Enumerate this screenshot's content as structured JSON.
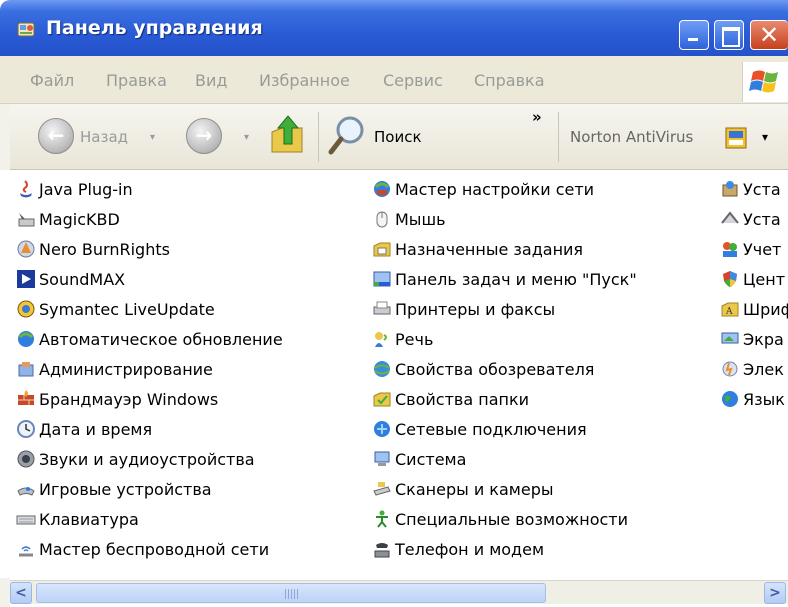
{
  "window": {
    "title": "Панель управления",
    "colors": {
      "titlebar": "#2a5bd6",
      "close": "#c7401d",
      "menubar": "#ece9d8"
    }
  },
  "menu": [
    "Файл",
    "Правка",
    "Вид",
    "Избранное",
    "Сервис",
    "Справка"
  ],
  "toolbar": {
    "back_label": "Назад",
    "search_label": "Поиск",
    "overflow": "»",
    "norton_label": "Norton AntiVirus",
    "dropdown": "▾"
  },
  "items": {
    "col1": [
      {
        "label": "Java Plug-in",
        "icon": "java-icon"
      },
      {
        "label": "MagicKBD",
        "icon": "keyboard-hand-icon"
      },
      {
        "label": "Nero BurnRights",
        "icon": "nero-icon"
      },
      {
        "label": "SoundMAX",
        "icon": "soundmax-icon"
      },
      {
        "label": "Symantec LiveUpdate",
        "icon": "liveupdate-icon"
      },
      {
        "label": "Автоматическое обновление",
        "icon": "auto-update-icon"
      },
      {
        "label": "Администрирование",
        "icon": "admin-tools-icon"
      },
      {
        "label": "Брандмауэр Windows",
        "icon": "firewall-icon"
      },
      {
        "label": "Дата и время",
        "icon": "clock-icon"
      },
      {
        "label": "Звуки и аудиоустройства",
        "icon": "speaker-icon"
      },
      {
        "label": "Игровые устройства",
        "icon": "joystick-icon"
      },
      {
        "label": "Клавиатура",
        "icon": "keyboard-icon"
      },
      {
        "label": "Мастер беспроводной сети",
        "icon": "wireless-icon"
      }
    ],
    "col2": [
      {
        "label": "Мастер настройки сети",
        "icon": "network-setup-icon"
      },
      {
        "label": "Мышь",
        "icon": "mouse-icon"
      },
      {
        "label": "Назначенные задания",
        "icon": "scheduled-tasks-icon"
      },
      {
        "label": "Панель задач и меню \"Пуск\"",
        "icon": "taskbar-icon"
      },
      {
        "label": "Принтеры и факсы",
        "icon": "printer-icon"
      },
      {
        "label": "Речь",
        "icon": "speech-icon"
      },
      {
        "label": "Свойства обозревателя",
        "icon": "internet-options-icon"
      },
      {
        "label": "Свойства папки",
        "icon": "folder-options-icon"
      },
      {
        "label": "Сетевые подключения",
        "icon": "network-connections-icon"
      },
      {
        "label": "Система",
        "icon": "system-icon"
      },
      {
        "label": "Сканеры и камеры",
        "icon": "scanner-icon"
      },
      {
        "label": "Специальные возможности",
        "icon": "accessibility-icon"
      },
      {
        "label": "Телефон и модем",
        "icon": "phone-modem-icon"
      }
    ],
    "col3": [
      {
        "label": "Уста",
        "icon": "install-icon"
      },
      {
        "label": "Уста",
        "icon": "add-remove-icon"
      },
      {
        "label": "Учет",
        "icon": "user-accounts-icon"
      },
      {
        "label": "Цент",
        "icon": "security-center-icon"
      },
      {
        "label": "Шриф",
        "icon": "fonts-folder-icon"
      },
      {
        "label": "Экра",
        "icon": "display-icon"
      },
      {
        "label": "Элек",
        "icon": "power-icon"
      },
      {
        "label": "Язык",
        "icon": "regional-globe-icon"
      }
    ]
  },
  "scrollbar": {
    "left": "<",
    "right": ">",
    "grip": "III"
  }
}
